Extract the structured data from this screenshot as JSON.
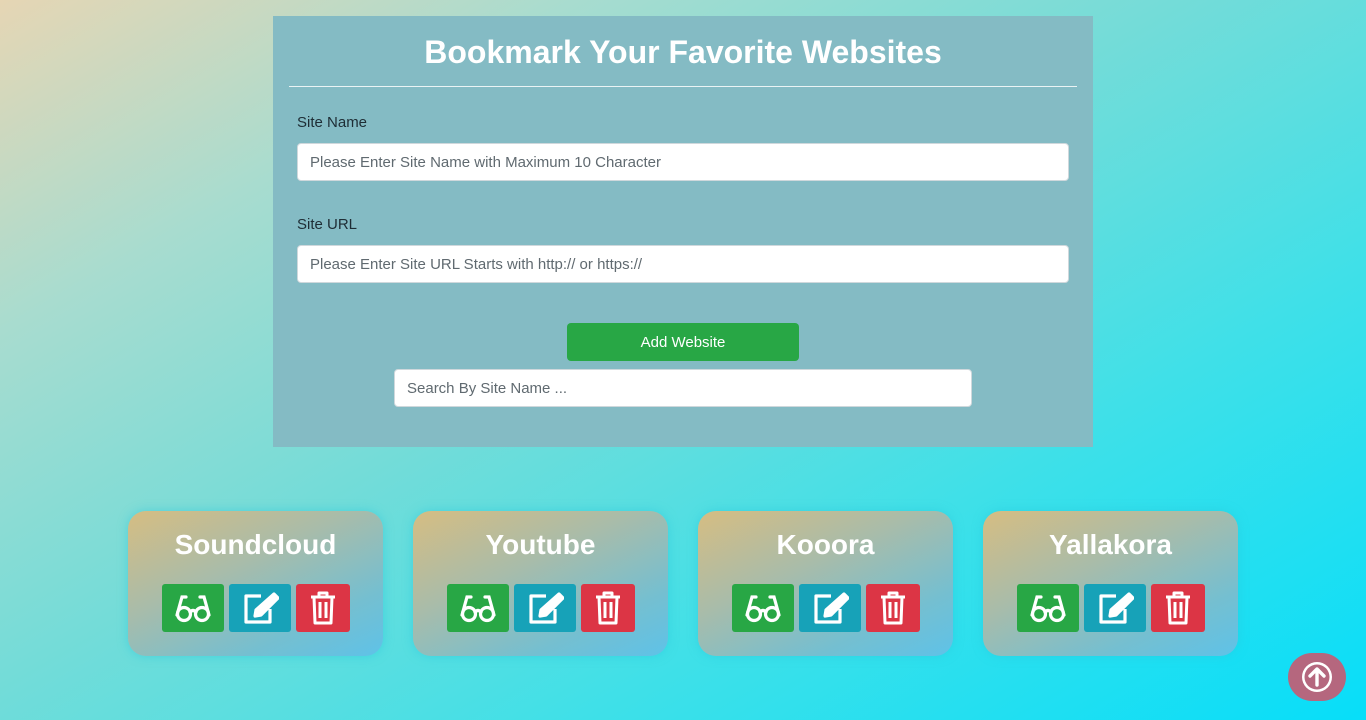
{
  "form": {
    "title": "Bookmark Your Favorite Websites",
    "site_name_label": "Site Name",
    "site_name_placeholder": "Please Enter Site Name with Maximum 10 Character",
    "site_url_label": "Site URL",
    "site_url_placeholder": "Please Enter Site URL Starts with http:// or https://",
    "add_button_label": "Add Website",
    "search_placeholder": "Search By Site Name ..."
  },
  "bookmarks": [
    {
      "name": "Soundcloud"
    },
    {
      "name": "Youtube"
    },
    {
      "name": "Kooora"
    },
    {
      "name": "Yallakora"
    }
  ],
  "icons": {
    "view": "glasses-icon",
    "edit": "edit-icon",
    "delete": "trash-icon",
    "scroll_top": "arrow-up-circle-icon"
  },
  "colors": {
    "view_button": "#28a745",
    "edit_button": "#17a2b8",
    "delete_button": "#dc3545",
    "add_button": "#28a745",
    "scroll_top_button": "#b5677e"
  }
}
